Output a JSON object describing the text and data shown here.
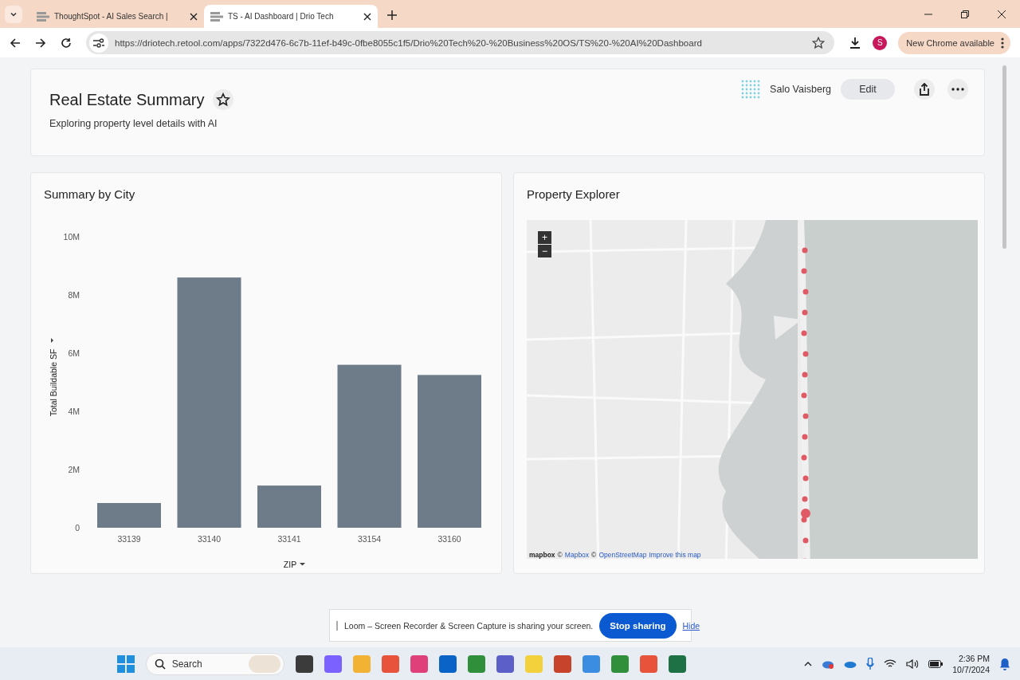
{
  "browser": {
    "tabs": [
      {
        "title": "ThoughtSpot - AI Sales Search |",
        "selected": false
      },
      {
        "title": "TS - AI Dashboard | Drio Tech",
        "selected": true
      }
    ],
    "url": "https://driotech.retool.com/apps/7322d476-6c7b-11ef-b49c-0fbe8055c1f5/Drio%20Tech%20-%20Business%20OS/TS%20-%20AI%20Dashboard",
    "profile_initial": "S",
    "update_button": "New Chrome available"
  },
  "header": {
    "title": "Real Estate Summary",
    "subtitle": "Exploring property level details with AI",
    "user": "Salo Vaisberg",
    "edit_button": "Edit"
  },
  "summary_card": {
    "title": "Summary by City",
    "chart_data": {
      "type": "bar",
      "xlabel": "ZIP",
      "ylabel": "Total Buildable SF",
      "categories": [
        "33139",
        "33140",
        "33141",
        "33154",
        "33160"
      ],
      "series": [
        {
          "color": "#6e7b88",
          "values": [
            850000,
            8600000,
            1450000,
            5600000,
            5250000
          ]
        }
      ],
      "ylim": [
        0,
        10000000
      ],
      "yticks": [
        {
          "value": 0,
          "label": "0"
        },
        {
          "value": 2000000,
          "label": "2M"
        },
        {
          "value": 4000000,
          "label": "4M"
        },
        {
          "value": 6000000,
          "label": "6M"
        },
        {
          "value": 8000000,
          "label": "8M"
        },
        {
          "value": 10000000,
          "label": "10M"
        }
      ]
    }
  },
  "map_card": {
    "title": "Property Explorer",
    "zoom_in": "+",
    "zoom_out": "−",
    "logo": "mapbox",
    "attribution": [
      {
        "text": "©",
        "link": false
      },
      {
        "text": "Mapbox",
        "link": true
      },
      {
        "text": "©",
        "link": false
      },
      {
        "text": "OpenStreetMap",
        "link": true
      },
      {
        "text": "Improve this map",
        "link": true
      }
    ]
  },
  "share_bar": {
    "message": "Loom – Screen Recorder & Screen Capture is sharing your screen.",
    "stop_button": "Stop sharing",
    "hide_link": "Hide"
  },
  "taskbar": {
    "search_placeholder": "Search",
    "time": "2:36 PM",
    "date": "10/7/2024"
  }
}
